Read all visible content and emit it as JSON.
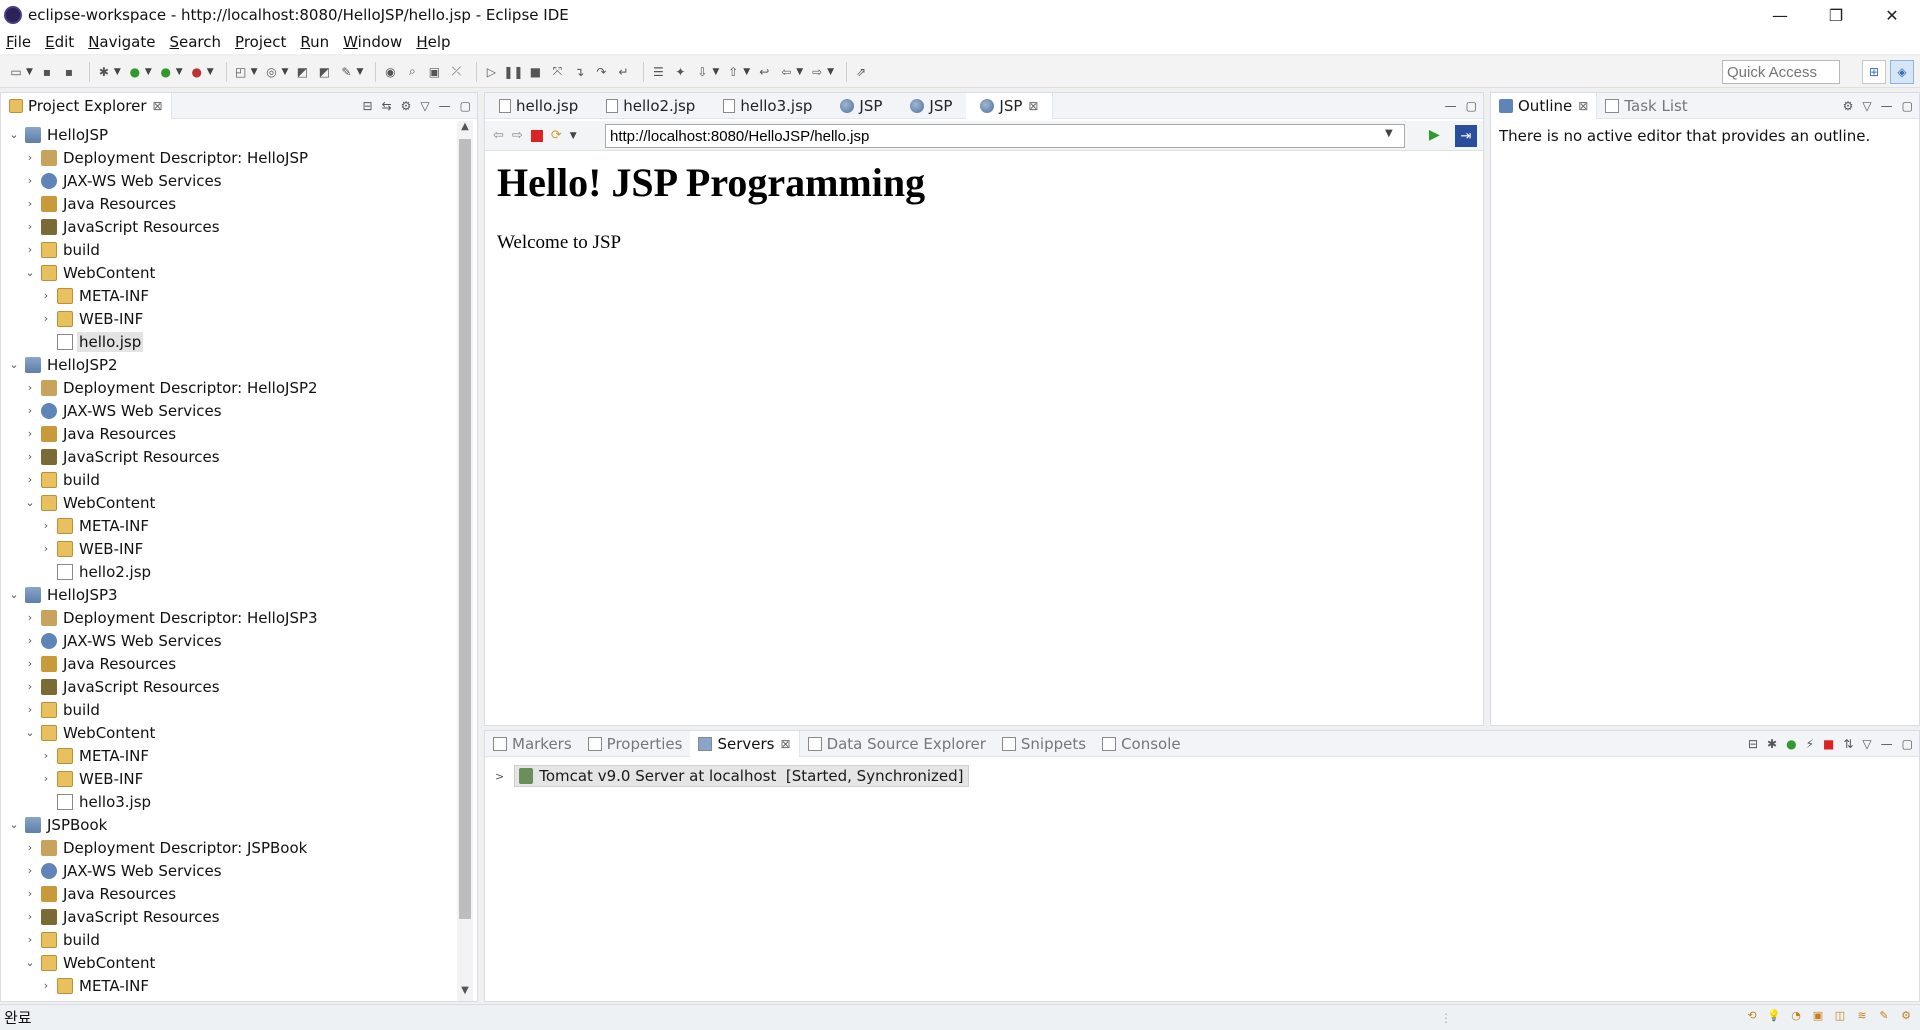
{
  "window": {
    "title": "eclipse-workspace - http://localhost:8080/HelloJSP/hello.jsp - Eclipse IDE",
    "minimize": "—",
    "restore": "❐",
    "close": "✕"
  },
  "menu": [
    "File",
    "Edit",
    "Navigate",
    "Search",
    "Project",
    "Run",
    "Window",
    "Help"
  ],
  "toolbar": {
    "quick_access_placeholder": "Quick Access"
  },
  "explorer": {
    "title": "Project Explorer",
    "close": "⊠",
    "tree": [
      {
        "label": "HelloJSP",
        "level": 0,
        "icon": "project",
        "twisty": "v"
      },
      {
        "label": "Deployment Descriptor: HelloJSP",
        "level": 1,
        "icon": "dd",
        "twisty": ">"
      },
      {
        "label": "JAX-WS Web Services",
        "level": 1,
        "icon": "ws",
        "twisty": ">"
      },
      {
        "label": "Java Resources",
        "level": 1,
        "icon": "java",
        "twisty": ">"
      },
      {
        "label": "JavaScript Resources",
        "level": 1,
        "icon": "js",
        "twisty": ">"
      },
      {
        "label": "build",
        "level": 1,
        "icon": "folder",
        "twisty": ">"
      },
      {
        "label": "WebContent",
        "level": 1,
        "icon": "folder",
        "twisty": "v"
      },
      {
        "label": "META-INF",
        "level": 2,
        "icon": "folder",
        "twisty": ">"
      },
      {
        "label": "WEB-INF",
        "level": 2,
        "icon": "folder",
        "twisty": ">"
      },
      {
        "label": "hello.jsp",
        "level": 2,
        "icon": "file",
        "twisty": "",
        "selected": true
      },
      {
        "label": "HelloJSP2",
        "level": 0,
        "icon": "project",
        "twisty": "v"
      },
      {
        "label": "Deployment Descriptor: HelloJSP2",
        "level": 1,
        "icon": "dd",
        "twisty": ">"
      },
      {
        "label": "JAX-WS Web Services",
        "level": 1,
        "icon": "ws",
        "twisty": ">"
      },
      {
        "label": "Java Resources",
        "level": 1,
        "icon": "java",
        "twisty": ">"
      },
      {
        "label": "JavaScript Resources",
        "level": 1,
        "icon": "js",
        "twisty": ">"
      },
      {
        "label": "build",
        "level": 1,
        "icon": "folder",
        "twisty": ">"
      },
      {
        "label": "WebContent",
        "level": 1,
        "icon": "folder",
        "twisty": "v"
      },
      {
        "label": "META-INF",
        "level": 2,
        "icon": "folder",
        "twisty": ">"
      },
      {
        "label": "WEB-INF",
        "level": 2,
        "icon": "folder",
        "twisty": ">"
      },
      {
        "label": "hello2.jsp",
        "level": 2,
        "icon": "file",
        "twisty": ""
      },
      {
        "label": "HelloJSP3",
        "level": 0,
        "icon": "project",
        "twisty": "v"
      },
      {
        "label": "Deployment Descriptor: HelloJSP3",
        "level": 1,
        "icon": "dd",
        "twisty": ">"
      },
      {
        "label": "JAX-WS Web Services",
        "level": 1,
        "icon": "ws",
        "twisty": ">"
      },
      {
        "label": "Java Resources",
        "level": 1,
        "icon": "java",
        "twisty": ">"
      },
      {
        "label": "JavaScript Resources",
        "level": 1,
        "icon": "js",
        "twisty": ">"
      },
      {
        "label": "build",
        "level": 1,
        "icon": "folder",
        "twisty": ">"
      },
      {
        "label": "WebContent",
        "level": 1,
        "icon": "folder",
        "twisty": "v"
      },
      {
        "label": "META-INF",
        "level": 2,
        "icon": "folder",
        "twisty": ">"
      },
      {
        "label": "WEB-INF",
        "level": 2,
        "icon": "folder",
        "twisty": ">"
      },
      {
        "label": "hello3.jsp",
        "level": 2,
        "icon": "file",
        "twisty": ""
      },
      {
        "label": "JSPBook",
        "level": 0,
        "icon": "project",
        "twisty": "v"
      },
      {
        "label": "Deployment Descriptor: JSPBook",
        "level": 1,
        "icon": "dd",
        "twisty": ">"
      },
      {
        "label": "JAX-WS Web Services",
        "level": 1,
        "icon": "ws",
        "twisty": ">"
      },
      {
        "label": "Java Resources",
        "level": 1,
        "icon": "java",
        "twisty": ">"
      },
      {
        "label": "JavaScript Resources",
        "level": 1,
        "icon": "js",
        "twisty": ">"
      },
      {
        "label": "build",
        "level": 1,
        "icon": "folder",
        "twisty": ">"
      },
      {
        "label": "WebContent",
        "level": 1,
        "icon": "folder",
        "twisty": "v"
      },
      {
        "label": "META-INF",
        "level": 2,
        "icon": "folder",
        "twisty": ">"
      }
    ]
  },
  "editor": {
    "tabs": [
      {
        "label": "hello.jsp",
        "icon": "file"
      },
      {
        "label": "hello2.jsp",
        "icon": "file"
      },
      {
        "label": "hello3.jsp",
        "icon": "file"
      },
      {
        "label": "JSP",
        "icon": "globe"
      },
      {
        "label": "JSP",
        "icon": "globe"
      },
      {
        "label": "JSP",
        "icon": "globe",
        "active": true
      }
    ],
    "url": "http://localhost:8080/HelloJSP/hello.jsp",
    "page_heading": "Hello! JSP Programming",
    "page_text": "Welcome to JSP"
  },
  "outline": {
    "tabs": [
      "Outline",
      "Task List"
    ],
    "message": "There is no active editor that provides an outline."
  },
  "servers": {
    "tabs": [
      "Markers",
      "Properties",
      "Servers",
      "Data Source Explorer",
      "Snippets",
      "Console"
    ],
    "active_tab": "Servers",
    "server_name": "Tomcat v9.0 Server at localhost",
    "server_state": "[Started, Synchronized]"
  },
  "status": {
    "text": "완료"
  }
}
